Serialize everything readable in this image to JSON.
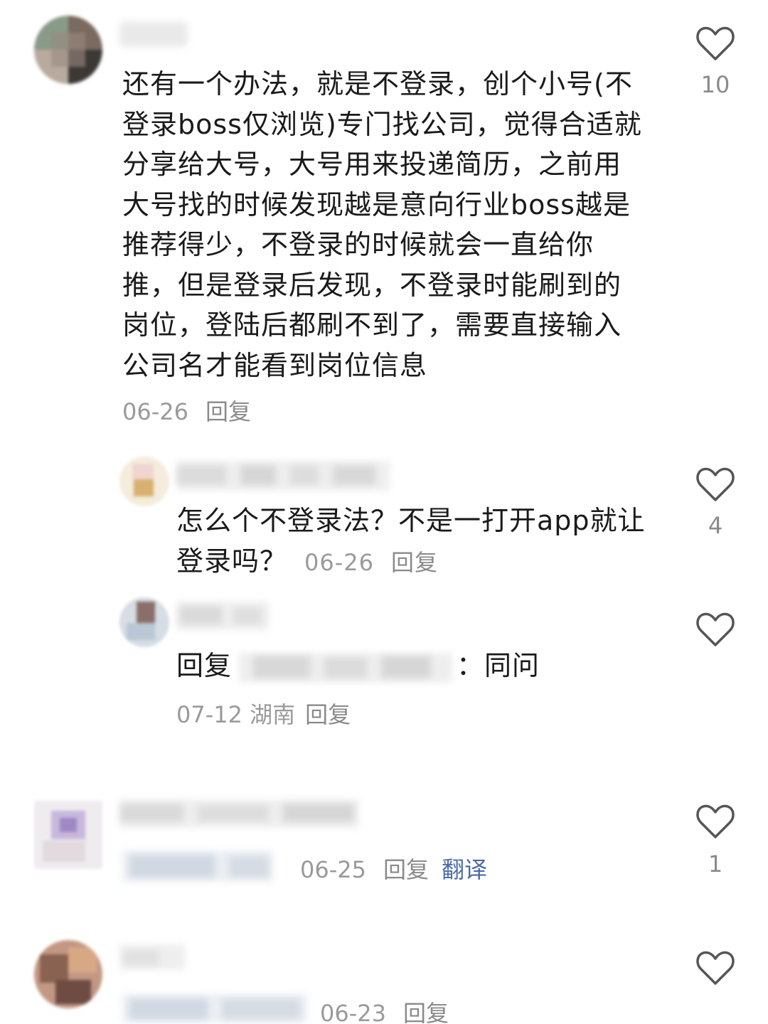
{
  "comments": [
    {
      "text": "还有一个办法，就是不登录，创个小号(不登录boss仅浏览)专门找公司，觉得合适就分享给大号，大号用来投递简历，之前用大号找的时候发现越是意向行业boss越是推荐得少，不登录的时候就会一直给你推，但是登录后发现，不登录时能刷到的岗位，登陆后都刷不到了，需要直接输入公司名才能看到岗位信息",
      "date": "06-26",
      "reply_label": "回复",
      "like_count": "10",
      "replies": [
        {
          "text": "怎么个不登录法？不是一打开app就让登录吗？",
          "date": "06-26",
          "reply_label": "回复",
          "like_count": "4"
        },
        {
          "reply_prefix": "回复",
          "reply_suffix": "：同问",
          "date": "07-12",
          "location": "湖南",
          "reply_label": "回复",
          "like_count": ""
        }
      ]
    },
    {
      "date": "06-25",
      "reply_label": "回复",
      "translate_label": "翻译",
      "like_count": "1"
    },
    {
      "date": "06-23",
      "reply_label": "回复",
      "like_count": ""
    }
  ],
  "colors": {
    "text": "#1a1a1a",
    "meta": "#9a9a9a",
    "translate": "#4a6aa8",
    "icon": "#555555"
  },
  "icons": {
    "like": "heart-outline-icon"
  }
}
